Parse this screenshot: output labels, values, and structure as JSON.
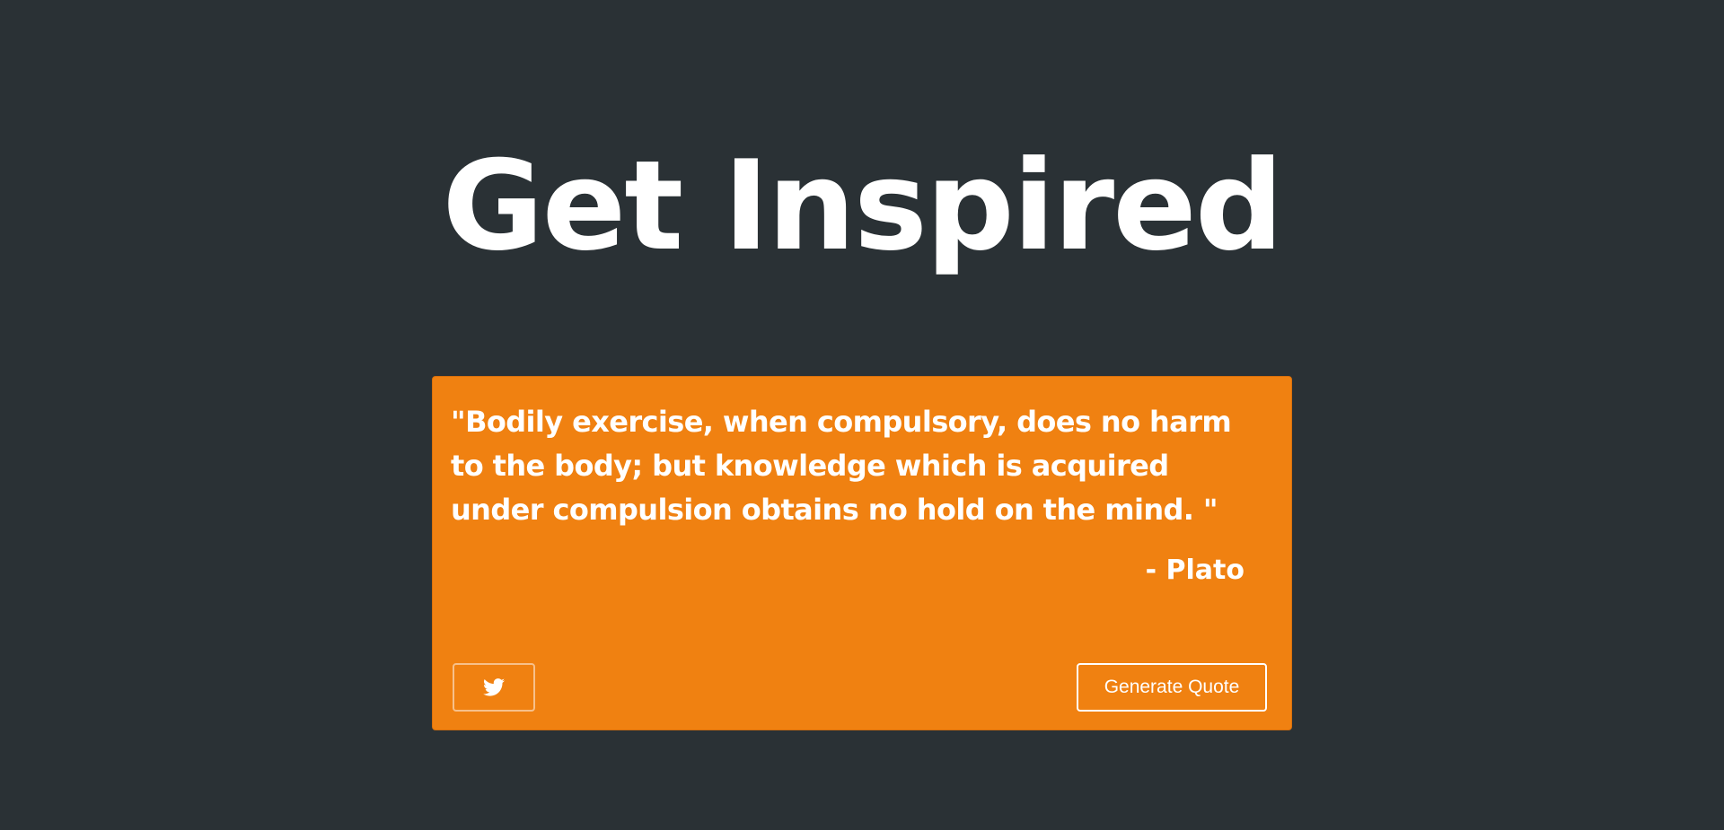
{
  "header": {
    "title": "Get Inspired"
  },
  "quote_card": {
    "quote_text": "\"Bodily exercise, when compulsory, does no harm to the body; but knowledge which is acquired under compulsion obtains no hold on the mind. \"",
    "author": "- Plato",
    "tweet_button_icon": "twitter-icon",
    "generate_button_label": "Generate Quote"
  },
  "colors": {
    "background": "#2a3135",
    "card": "#f08111",
    "text": "#ffffff"
  }
}
